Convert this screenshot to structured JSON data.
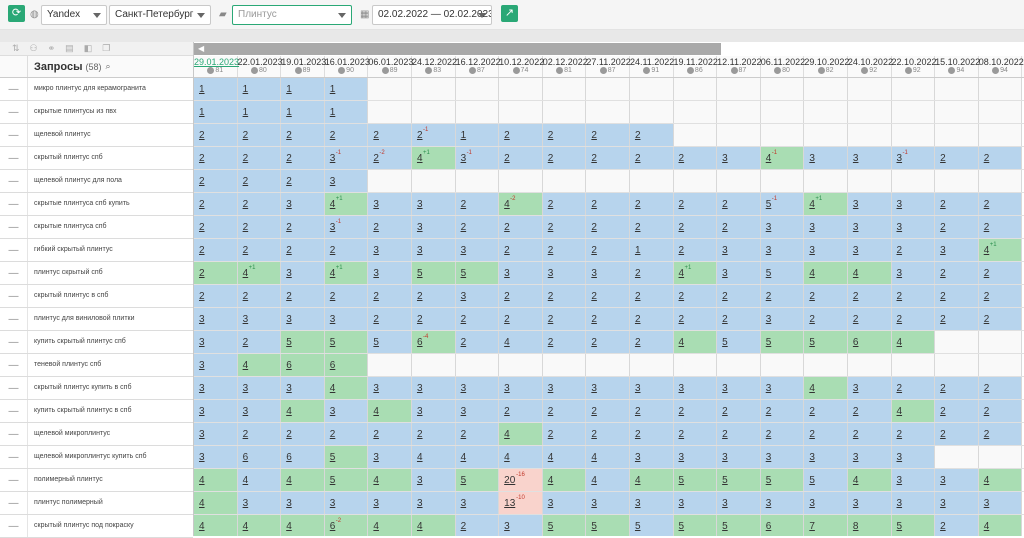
{
  "toolbar": {
    "engine": "Yandex",
    "city": "Санкт-Петербург",
    "search_placeholder": "Плинтус",
    "date_range": "02.02.2022 — 02.02.2023"
  },
  "left": {
    "header": "Запросы",
    "count": "(58)",
    "rows": [
      {
        "label": "микро плинтус для керамогранита"
      },
      {
        "label": "скрытые плинтусы из пвх"
      },
      {
        "label": "щелевой плинтус"
      },
      {
        "label": "скрытый плинтус спб"
      },
      {
        "label": "щелевой плинтус для пола"
      },
      {
        "label": "скрытые плинтуса спб купить"
      },
      {
        "label": "скрытые плинтуса спб"
      },
      {
        "label": "гибкий скрытый плинтус"
      },
      {
        "label": "плинтус скрытый спб"
      },
      {
        "label": "скрытый плинтус в спб"
      },
      {
        "label": "плинтус для виниловой плитки"
      },
      {
        "label": "купить скрытый плинтус спб"
      },
      {
        "label": "теневой плинтус спб"
      },
      {
        "label": "скрытый плинтус купить в спб"
      },
      {
        "label": "купить скрытый плинтус в спб"
      },
      {
        "label": "щелевой микроплинтус"
      },
      {
        "label": "щелевой микроплинтус купить спб"
      },
      {
        "label": "полимерный плинтус"
      },
      {
        "label": "плинтус полимерный"
      },
      {
        "label": "скрытый плинтус под покраску"
      }
    ]
  },
  "dates": [
    {
      "d": "29.01.2023",
      "s": "81"
    },
    {
      "d": "22.01.2023",
      "s": "80"
    },
    {
      "d": "19.01.2023",
      "s": "89"
    },
    {
      "d": "16.01.2023",
      "s": "90"
    },
    {
      "d": "06.01.2023",
      "s": "89"
    },
    {
      "d": "24.12.2022",
      "s": "83"
    },
    {
      "d": "16.12.2022",
      "s": "87"
    },
    {
      "d": "10.12.2022",
      "s": "74"
    },
    {
      "d": "02.12.2022",
      "s": "81"
    },
    {
      "d": "27.11.2022",
      "s": "87"
    },
    {
      "d": "24.11.2022",
      "s": "91"
    },
    {
      "d": "19.11.2022",
      "s": "86"
    },
    {
      "d": "12.11.2022",
      "s": "87"
    },
    {
      "d": "06.11.2022",
      "s": "80"
    },
    {
      "d": "29.10.2022",
      "s": "82"
    },
    {
      "d": "24.10.2022",
      "s": "92"
    },
    {
      "d": "22.10.2022",
      "s": "92"
    },
    {
      "d": "15.10.2022",
      "s": "94"
    },
    {
      "d": "08.10.2022",
      "s": "94"
    }
  ],
  "grid": [
    [
      "b1",
      "b1",
      "b1",
      "b1",
      "e",
      "e",
      "e",
      "e",
      "e",
      "e",
      "e",
      "e",
      "e",
      "e",
      "e",
      "e",
      "e",
      "e",
      "e",
      "e"
    ],
    [
      "b1",
      "b1",
      "b1",
      "b1",
      "e",
      "e",
      "e",
      "e",
      "e",
      "e",
      "e",
      "e",
      "e",
      "e",
      "e",
      "e",
      "e",
      "e",
      "e",
      "e"
    ],
    [
      "b2",
      "b2",
      "b2",
      "b2",
      "b2",
      "b2-1",
      "b1",
      "b2",
      "b2",
      "b2",
      "b2",
      "e",
      "e",
      "e",
      "e",
      "e",
      "e",
      "e",
      "e",
      "e"
    ],
    [
      "b2",
      "b2",
      "b2",
      "b3-1",
      "b2-2",
      "g4+1",
      "b3-1",
      "b2",
      "b2",
      "b2",
      "b2",
      "b2",
      "b3",
      "g4-1",
      "b3",
      "b3",
      "b3-1",
      "b2",
      "b2"
    ],
    [
      "b2",
      "b2",
      "b2",
      "b3",
      "e",
      "e",
      "e",
      "e",
      "e",
      "e",
      "e",
      "e",
      "e",
      "e",
      "e",
      "e",
      "e",
      "e",
      "e",
      "e"
    ],
    [
      "b2",
      "b2",
      "b3",
      "g4+1",
      "b3",
      "b3",
      "b2",
      "g4-2",
      "b2",
      "b2",
      "b2",
      "b2",
      "b2",
      "b5-1",
      "g4+1",
      "b3",
      "b3",
      "b2",
      "b2"
    ],
    [
      "b2",
      "b2",
      "b2",
      "b3-1",
      "b2",
      "b3",
      "b2",
      "b2",
      "b2",
      "b2",
      "b2",
      "b2",
      "b2",
      "b3",
      "b3",
      "b3",
      "b3",
      "b2",
      "b2"
    ],
    [
      "b2",
      "b2",
      "b2",
      "b2",
      "b3",
      "b3",
      "b3",
      "b2",
      "b2",
      "b2",
      "b1",
      "b2",
      "b3",
      "b3",
      "b3",
      "b3",
      "b2",
      "b3",
      "g4+1"
    ],
    [
      "g2",
      "g4+1",
      "b3",
      "g4+1",
      "b3",
      "g5",
      "g5",
      "b3",
      "b3",
      "b3",
      "b2",
      "g4+1",
      "b3",
      "b5",
      "g4",
      "g4",
      "b3",
      "b2",
      "b2"
    ],
    [
      "b2",
      "b2",
      "b2",
      "b2",
      "b2",
      "b2",
      "b3",
      "b2",
      "b2",
      "b2",
      "b2",
      "b2",
      "b2",
      "b2",
      "b2",
      "b2",
      "b2",
      "b2",
      "b2"
    ],
    [
      "b3",
      "b3",
      "b3",
      "b3",
      "b2",
      "b2",
      "b2",
      "b2",
      "b2",
      "b2",
      "b2",
      "b2",
      "b2",
      "b3",
      "b2",
      "b2",
      "b2",
      "b2",
      "b2"
    ],
    [
      "b3",
      "b2",
      "g5",
      "g5",
      "b5",
      "g6-4",
      "b2",
      "b4",
      "b2",
      "b2",
      "b2",
      "g4",
      "b5",
      "g5",
      "g5",
      "g6",
      "g4",
      "e",
      "e"
    ],
    [
      "b3",
      "g4",
      "g6",
      "g6",
      "e",
      "e",
      "e",
      "e",
      "e",
      "e",
      "e",
      "e",
      "e",
      "e",
      "e",
      "e",
      "e",
      "e",
      "e"
    ],
    [
      "b3",
      "b3",
      "b3",
      "g4",
      "b3",
      "b3",
      "b3",
      "b3",
      "b3",
      "b3",
      "b3",
      "b3",
      "b3",
      "b3",
      "g4",
      "b3",
      "b2",
      "b2",
      "b2"
    ],
    [
      "b3",
      "b3",
      "g4",
      "b3",
      "g4",
      "b3",
      "b3",
      "b2",
      "b2",
      "b2",
      "b2",
      "b2",
      "b2",
      "b2",
      "b2",
      "b2",
      "g4",
      "b2",
      "b2"
    ],
    [
      "b3",
      "b2",
      "b2",
      "b2",
      "b2",
      "b2",
      "b2",
      "g4",
      "b2",
      "b2",
      "b2",
      "b2",
      "b2",
      "b2",
      "b2",
      "b2",
      "b2",
      "b2",
      "b2"
    ],
    [
      "b3",
      "b6",
      "b6",
      "g5",
      "b3",
      "b4",
      "b4",
      "b4",
      "b4",
      "b4",
      "b3",
      "b3",
      "b3",
      "b3",
      "b3",
      "b3",
      "b3",
      "e",
      "e"
    ],
    [
      "g4",
      "b4",
      "g4",
      "g5",
      "g4",
      "b3",
      "g5",
      "r20-16",
      "g4",
      "b4",
      "g4",
      "g5",
      "g5",
      "g5",
      "b5",
      "g4",
      "b3",
      "b3",
      "g4"
    ],
    [
      "g4",
      "b3",
      "b3",
      "b3",
      "b3",
      "b3",
      "b3",
      "r13-10",
      "b3",
      "b3",
      "b3",
      "b3",
      "b3",
      "b3",
      "b3",
      "b3",
      "b3",
      "b3",
      "b3"
    ],
    [
      "g4",
      "g4",
      "g4",
      "g6-2",
      "g4",
      "g4",
      "b2",
      "b3",
      "g5",
      "g5",
      "b5",
      "g5",
      "g5",
      "g6",
      "g7",
      "g8",
      "g5",
      "b2",
      "g4"
    ]
  ]
}
